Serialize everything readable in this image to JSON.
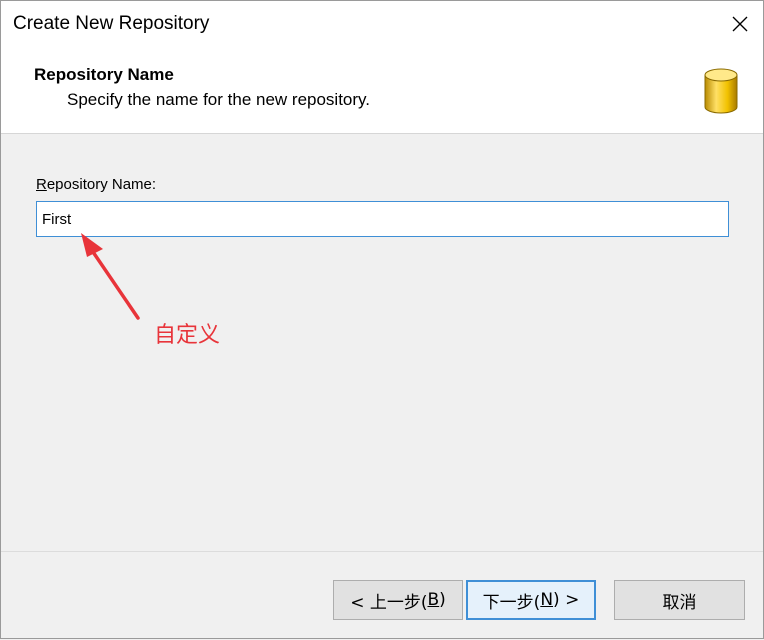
{
  "window": {
    "title": "Create New Repository"
  },
  "header": {
    "title": "Repository Name",
    "subtitle": "Specify the name for the new repository.",
    "icon": "database-icon"
  },
  "form": {
    "label_prefix": "",
    "label_mnemonic": "R",
    "label_rest": "epository Name:",
    "name_value": "First"
  },
  "annotation": {
    "text": "自定义",
    "color": "#e8343a"
  },
  "buttons": {
    "back_prefix": "< 上一步(",
    "back_mnemonic": "B",
    "back_suffix": ")",
    "next_prefix": "下一步(",
    "next_mnemonic": "N",
    "next_suffix": ") >",
    "cancel": "取消"
  }
}
